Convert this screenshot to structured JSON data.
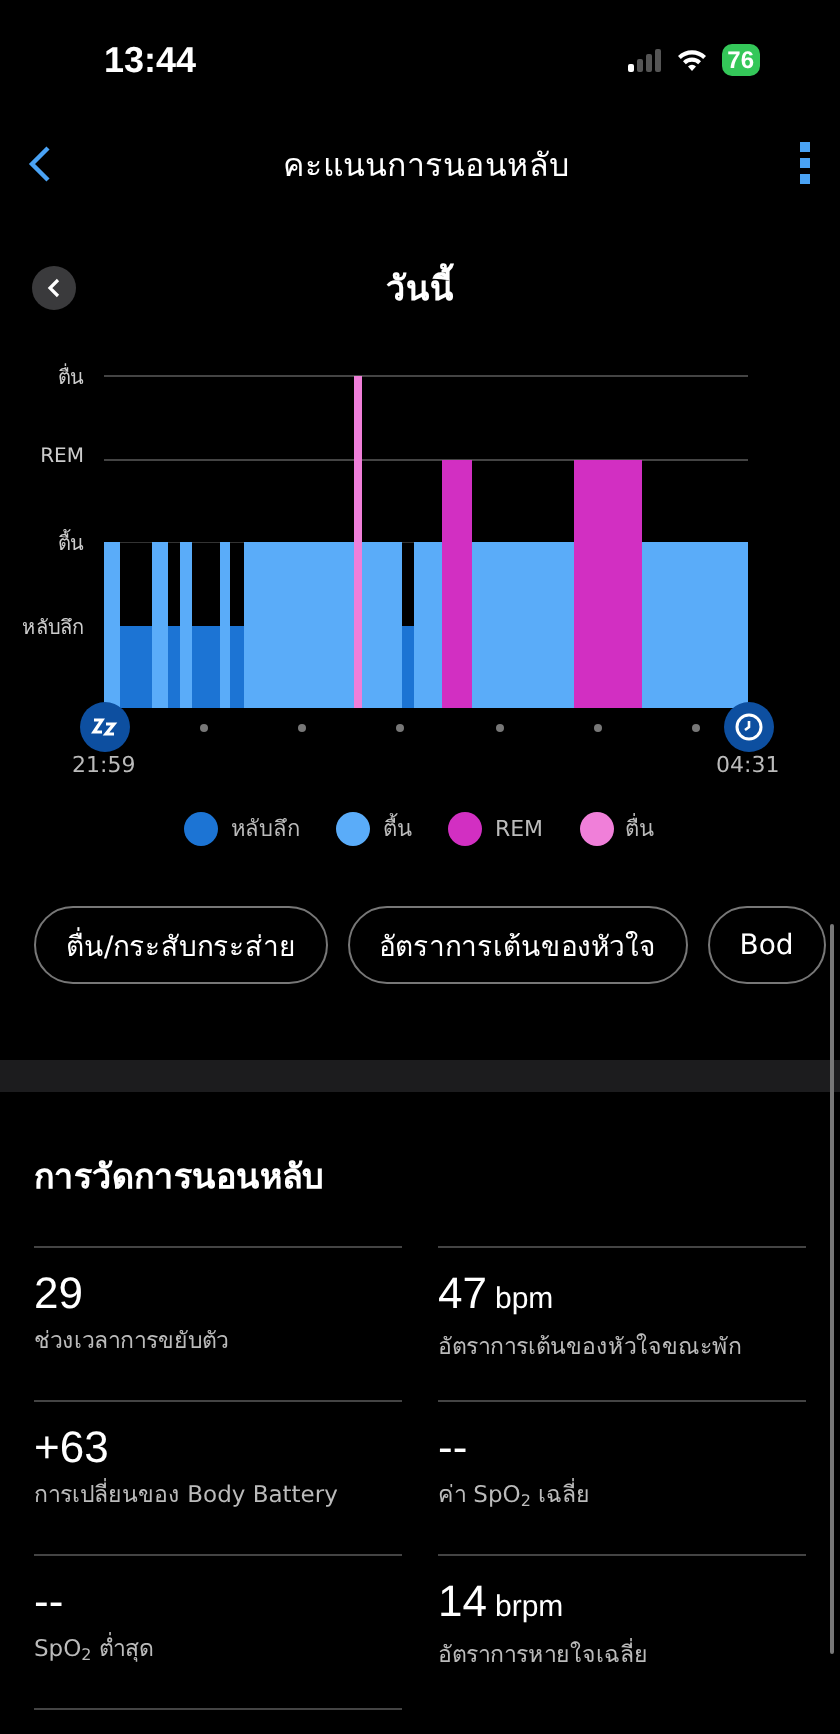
{
  "status_bar": {
    "time": "13:44",
    "battery": "76"
  },
  "nav": {
    "title": "คะแนนการนอนหลับ"
  },
  "date_header": {
    "label": "วันนี้"
  },
  "hypnogram": {
    "stages": [
      "ตื่น",
      "REM",
      "ตื้น",
      "หลับลึก"
    ],
    "start_time": "21:59",
    "end_time": "04:31"
  },
  "legend": [
    {
      "label": "หลับลึก",
      "color": "#1c74d4"
    },
    {
      "label": "ตื้น",
      "color": "#5aacf9"
    },
    {
      "label": "REM",
      "color": "#d22fc2"
    },
    {
      "label": "ตื่น",
      "color": "#f07fd9"
    }
  ],
  "chips": [
    {
      "label": "ตื่น/กระสับกระส่าย"
    },
    {
      "label": "อัตราการเต้นของหัวใจ"
    },
    {
      "label": "Bod"
    }
  ],
  "section": {
    "title": "การวัดการนอนหลับ"
  },
  "metrics": [
    {
      "value": "29",
      "label": "ช่วงเวลาการขยับตัว"
    },
    {
      "value": "+63",
      "label": "การเปลี่ยนของ Body Battery"
    },
    {
      "value": "--",
      "label": "SpO$_{2}$ ต่ำสุด"
    },
    {
      "value": "47",
      "unit": "bpm",
      "label": "อัตราการเต้นของหัวใจขณะพัก"
    },
    {
      "value": "--",
      "label": "ค่า SpO$_{2}$ เฉลี่ย"
    },
    {
      "value": "14",
      "unit": "brpm",
      "label": "อัตราการหายใจเฉลี่ย"
    }
  ]
}
